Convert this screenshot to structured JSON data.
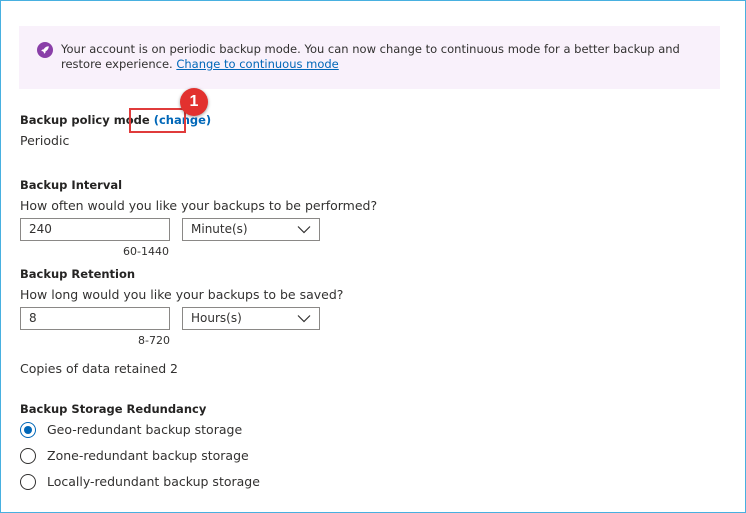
{
  "banner": {
    "icon": "rocket-icon",
    "message": "Your account is on periodic backup mode. You can now change to continuous mode for a better backup and restore experience.",
    "link": "Change to continuous mode"
  },
  "policy": {
    "label": "Backup policy mode",
    "change_link": "(change)",
    "value": "Periodic"
  },
  "callout": {
    "number": "1",
    "color": "#e2312e"
  },
  "interval": {
    "label": "Backup Interval",
    "question": "How often would you like your backups to be performed?",
    "value": "240",
    "unit": "Minute(s)",
    "range": "60-1440"
  },
  "retention": {
    "label": "Backup Retention",
    "question": "How long would you like your backups to be saved?",
    "value": "8",
    "unit": "Hours(s)",
    "range": "8-720"
  },
  "copies": {
    "label": "Copies of data retained",
    "value": "2"
  },
  "redundancy": {
    "label": "Backup Storage Redundancy",
    "options": [
      {
        "label": "Geo-redundant backup storage",
        "selected": true
      },
      {
        "label": "Zone-redundant backup storage",
        "selected": false
      },
      {
        "label": "Locally-redundant backup storage",
        "selected": false
      }
    ]
  },
  "colors": {
    "accent": "#0067b8",
    "banner_bg": "#f9f1fb",
    "banner_icon": "#8a3fa8"
  }
}
